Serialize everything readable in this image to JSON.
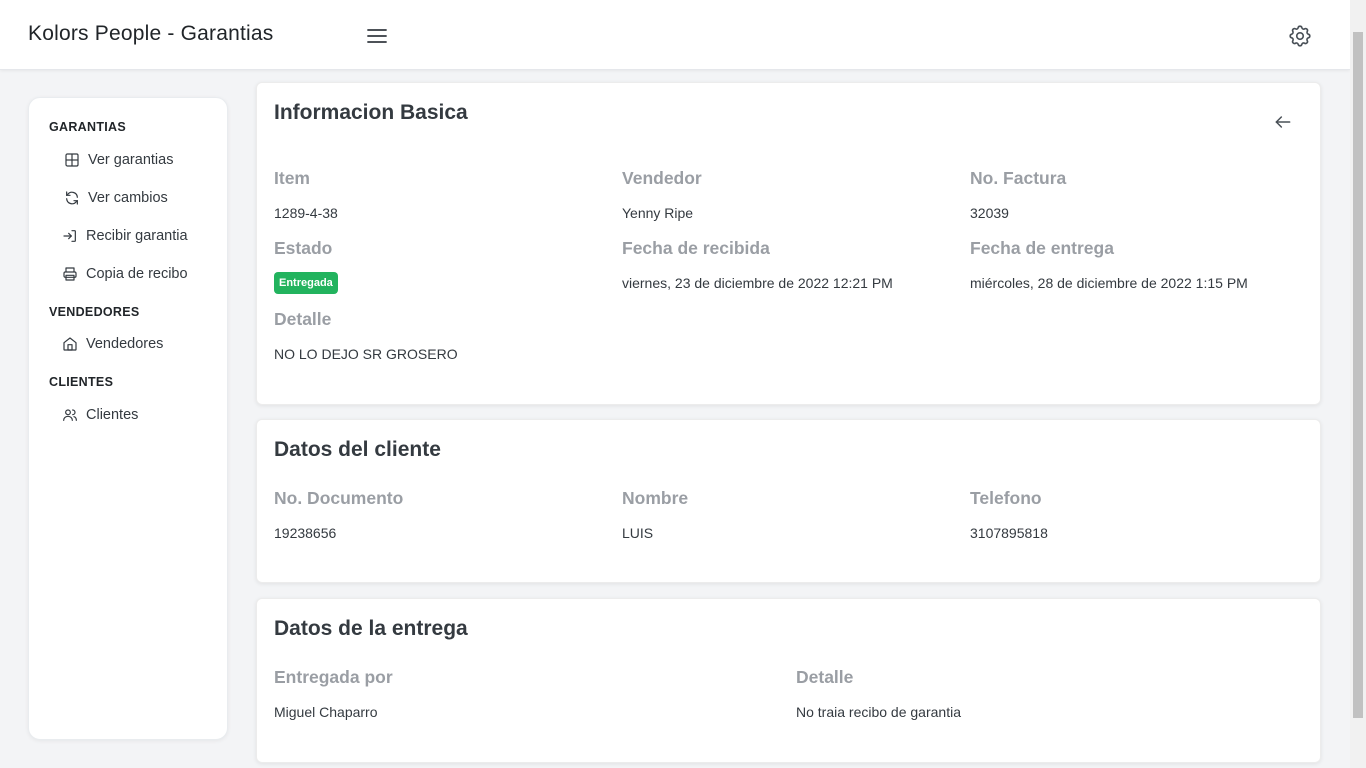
{
  "header": {
    "title": "Kolors People - Garantias",
    "menu_icon": "hamburger-menu-icon",
    "settings_icon": "gear-icon"
  },
  "sidebar": {
    "sections": [
      {
        "title": "GARANTIAS",
        "items": [
          {
            "label": "Ver garantias",
            "icon": "table-icon"
          },
          {
            "label": "Ver cambios",
            "icon": "refresh-icon"
          },
          {
            "label": "Recibir garantia",
            "icon": "login-icon"
          },
          {
            "label": "Copia de recibo",
            "icon": "printer-icon"
          }
        ]
      },
      {
        "title": "VENDEDORES",
        "items": [
          {
            "label": "Vendedores",
            "icon": "home-icon"
          }
        ]
      },
      {
        "title": "CLIENTES",
        "items": [
          {
            "label": "Clientes",
            "icon": "users-icon"
          }
        ]
      }
    ]
  },
  "info": {
    "title": "Informacion Basica",
    "back_icon": "arrow-left-icon",
    "item_label": "Item",
    "item_value": "1289-4-38",
    "vendedor_label": "Vendedor",
    "vendedor_value": "Yenny Ripe",
    "factura_label": "No. Factura",
    "factura_value": "32039",
    "estado_label": "Estado",
    "estado_badge": "Entregada",
    "recibida_label": "Fecha de recibida",
    "recibida_value": "viernes, 23 de diciembre de 2022 12:21 PM",
    "entrega_label": "Fecha de entrega",
    "entrega_value": "miércoles, 28 de diciembre de 2022 1:15 PM",
    "detalle_label": "Detalle",
    "detalle_value": "NO LO DEJO SR GROSERO"
  },
  "cliente": {
    "title": "Datos del cliente",
    "documento_label": "No. Documento",
    "documento_value": "19238656",
    "nombre_label": "Nombre",
    "nombre_value": "LUIS",
    "telefono_label": "Telefono",
    "telefono_value": "3107895818"
  },
  "entrega": {
    "title": "Datos de la entrega",
    "por_label": "Entregada por",
    "por_value": "Miguel Chaparro",
    "detalle_label": "Detalle",
    "detalle_value": "No traia recibo de garantia"
  },
  "colors": {
    "badge_green": "#22b35e",
    "label_gray": "#9a9ea4",
    "background": "#f3f4f6"
  }
}
